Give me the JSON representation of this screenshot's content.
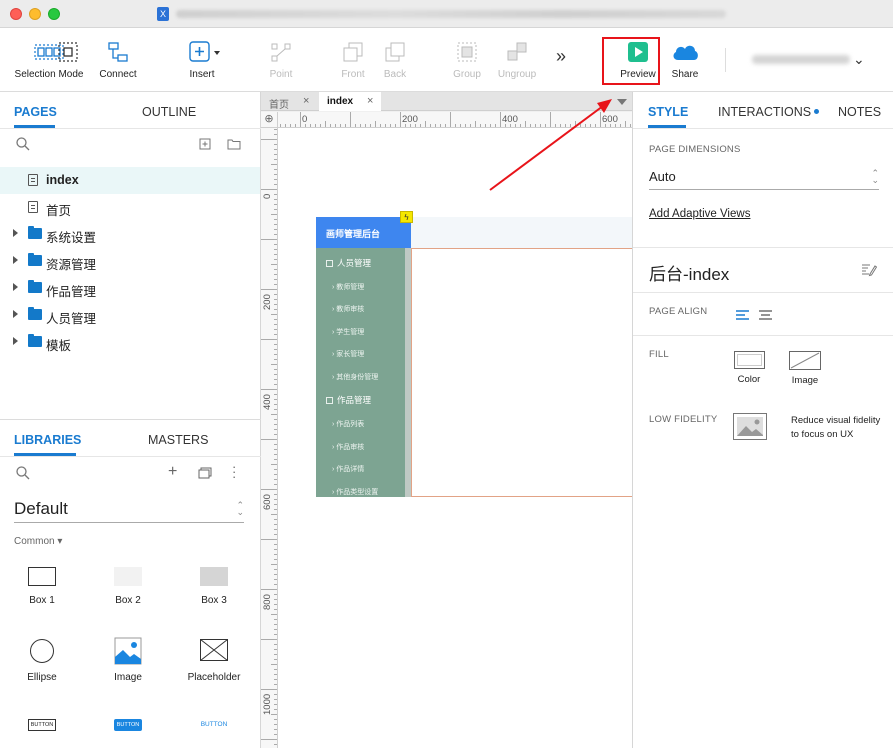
{
  "toolbar": {
    "selection_mode": "Selection Mode",
    "connect": "Connect",
    "insert": "Insert",
    "point": "Point",
    "front": "Front",
    "back": "Back",
    "group": "Group",
    "ungroup": "Ungroup",
    "more": "»",
    "preview": "Preview",
    "share": "Share"
  },
  "left": {
    "tabs": {
      "pages": "PAGES",
      "outline": "OUTLINE"
    },
    "pages": [
      {
        "label": "index",
        "type": "page",
        "selected": true
      },
      {
        "label": "首页",
        "type": "page"
      },
      {
        "label": "系统设置",
        "type": "folder"
      },
      {
        "label": "资源管理",
        "type": "folder"
      },
      {
        "label": "作品管理",
        "type": "folder"
      },
      {
        "label": "人员管理",
        "type": "folder"
      },
      {
        "label": "模板",
        "type": "folder"
      }
    ],
    "lib_tabs": {
      "libraries": "LIBRARIES",
      "masters": "MASTERS"
    },
    "library_name": "Default",
    "category": "Common ▾",
    "widgets": [
      {
        "label": "Box 1"
      },
      {
        "label": "Box 2"
      },
      {
        "label": "Box 3"
      },
      {
        "label": "Ellipse"
      },
      {
        "label": "Image"
      },
      {
        "label": "Placeholder"
      },
      {
        "label": "BUTTON"
      },
      {
        "label": "BUTTON"
      },
      {
        "label": "BUTTON"
      }
    ]
  },
  "canvas": {
    "tabs": [
      {
        "label": "首页"
      },
      {
        "label": "index"
      }
    ],
    "ruler_h": [
      "0",
      "200",
      "400",
      "600"
    ],
    "ruler_v": [
      "0",
      "200",
      "400",
      "600",
      "800",
      "1000"
    ],
    "design": {
      "logo": "画师管理后台",
      "groups": [
        {
          "title": "人员管理",
          "items": [
            "教师管理",
            "教师审核",
            "学生管理",
            "家长管理",
            "其他身份管理"
          ]
        },
        {
          "title": "作品管理",
          "items": [
            "作品列表",
            "作品审核",
            "作品详情",
            "作品类型设置"
          ]
        }
      ]
    }
  },
  "right": {
    "tabs": {
      "style": "STYLE",
      "interactions": "INTERACTIONS",
      "notes": "NOTES"
    },
    "page_dimensions_label": "PAGE DIMENSIONS",
    "page_dimensions_value": "Auto",
    "add_adaptive": "Add Adaptive Views",
    "page_name": "后台-index",
    "page_align_label": "PAGE ALIGN",
    "fill_label": "FILL",
    "fill_color": "Color",
    "fill_image": "Image",
    "low_fidelity_label": "LOW FIDELITY",
    "low_fidelity_desc_1": "Reduce visual fidelity",
    "low_fidelity_desc_2": "to focus on UX"
  },
  "colors": {
    "accent": "#1a7bd0",
    "preview_green": "#1fbf8f",
    "highlight_red": "#e8141a"
  }
}
